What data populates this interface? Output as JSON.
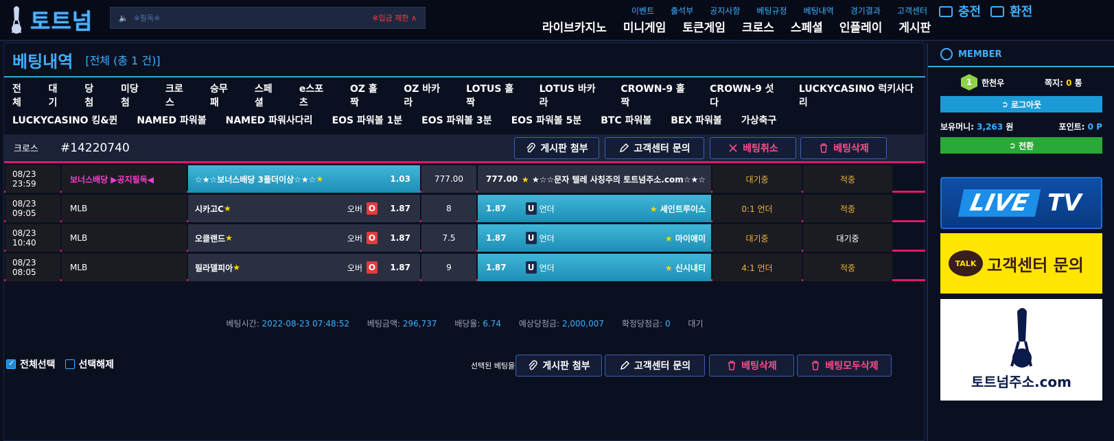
{
  "header": {
    "logo_text": "토트넘",
    "notice_text": "※필독※",
    "notice_warning": "※입금 제한 ∧",
    "subnav": [
      "이벤트",
      "출석부",
      "공지사항",
      "베팅규정",
      "베팅내역",
      "경기결과",
      "고객센터"
    ],
    "mainnav": [
      "라이브카지노",
      "미니게임",
      "토큰게임",
      "크로스",
      "스페셜",
      "인플레이",
      "게시판"
    ],
    "charge_label": "충전",
    "exchange_label": "환전"
  },
  "page": {
    "title": "베팅내역",
    "subtitle": "[전체 (총 1 건)]",
    "tabs_row1": [
      "전체",
      "대기",
      "당첨",
      "미당첨",
      "크로스",
      "승무패",
      "스페셜",
      "e스포츠",
      "OZ 홀짝",
      "OZ 바카라",
      "LOTUS 홀짝",
      "LOTUS 바카라",
      "CROWN-9 홀짝",
      "CROWN-9 섯다",
      "LUCKYCASINO 럭키사다리"
    ],
    "tabs_row2": [
      "LUCKYCASINO 킹&퀸",
      "NAMED 파워볼",
      "NAMED 파워사다리",
      "EOS 파워볼 1분",
      "EOS 파워볼 3분",
      "EOS 파워볼 5분",
      "BTC 파워볼",
      "BEX 파워볼",
      "가상축구"
    ]
  },
  "bet": {
    "type": "크로스",
    "id": "#14220740",
    "btn_board": "게시판 첨부",
    "btn_cs": "고객센터 문의",
    "btn_cancel": "베팅취소",
    "btn_delete": "베팅삭제",
    "rows": [
      {
        "date": "08/23 23:59",
        "league": "보너스배당 ▶공지필독◀",
        "home": "☆★☆보너스배당 3폴더이상☆★☆ ",
        "home_star": "★",
        "ou": "",
        "badge": "",
        "home_odd": "1.03",
        "mid": "777.00",
        "away_odd": "777.00",
        "away_badge": "",
        "away_label": "",
        "away_star": "★",
        "away": " ★☆☆문자 텔레 사칭주의 토트넘주소.com☆★☆",
        "status": "대기중",
        "result": "적중"
      },
      {
        "date": "08/23 09:05",
        "league": "MLB",
        "home": "시카고C ",
        "home_star": "★",
        "ou": "오버",
        "badge": "O",
        "home_odd": "1.87",
        "mid": "8",
        "away_odd": "1.87",
        "away_badge": "U",
        "away_label": "언더",
        "away_star": "★",
        "away": " 세인트루이스",
        "status": "0:1 언더",
        "result": "적중"
      },
      {
        "date": "08/23 10:40",
        "league": "MLB",
        "home": "오클랜드 ",
        "home_star": "★",
        "ou": "오버",
        "badge": "O",
        "home_odd": "1.87",
        "mid": "7.5",
        "away_odd": "1.87",
        "away_badge": "U",
        "away_label": "언더",
        "away_star": "★",
        "away": " 마이애미",
        "status": "대기중",
        "result": "대기중"
      },
      {
        "date": "08/23 08:05",
        "league": "MLB",
        "home": "필라델피아 ",
        "home_star": "★",
        "ou": "오버",
        "badge": "O",
        "home_odd": "1.87",
        "mid": "9",
        "away_odd": "1.87",
        "away_badge": "U",
        "away_label": "언더",
        "away_star": "★",
        "away": " 신시내티",
        "status": "4:1 언더",
        "result": "적중"
      }
    ],
    "summary": {
      "time_label": "베팅시간:",
      "time": "2022-08-23 07:48:52",
      "amount_label": "베팅금액:",
      "amount": "296,737",
      "odds_label": "배당율:",
      "odds": "6.74",
      "expected_label": "예상당첨금:",
      "expected": "2,000,007",
      "confirmed_label": "확정당첨금:",
      "confirmed": "0",
      "state": "대기"
    }
  },
  "footer": {
    "select_all": "전체선택",
    "deselect": "선택해제",
    "selected_label": "선택된 베팅을",
    "btn_board": "게시판 첨부",
    "btn_cs": "고객센터 문의",
    "btn_delete": "베팅삭제",
    "btn_delete_all": "베팅모두삭제"
  },
  "sidebar": {
    "member_label": "MEMBER",
    "level": "1",
    "username": "한천우",
    "memo_label": "쪽지:",
    "memo_count": "0",
    "memo_unit": "통",
    "logout": "로그아웃",
    "money_label": "보유머니:",
    "money": "3,263",
    "money_unit": "원",
    "point_label": "포인트:",
    "point": "0",
    "point_unit": "P",
    "convert": "전환",
    "banner_live_1": "LIVE",
    "banner_live_2": "TV",
    "banner_talk_badge": "TALK",
    "banner_talk": "고객센터 문의",
    "banner_site": "토트넘주소.com"
  }
}
